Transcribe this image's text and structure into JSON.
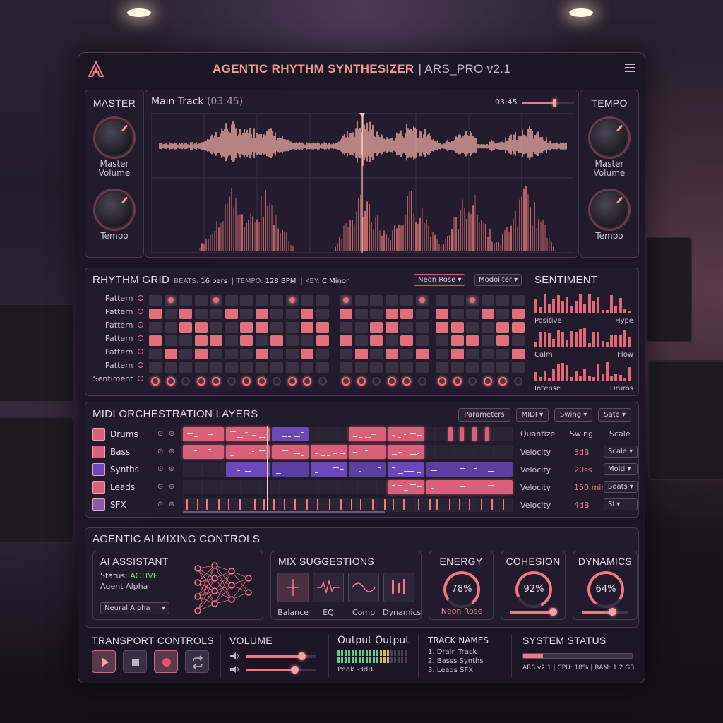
{
  "app": {
    "title": "AGENTIC RHYTHM SYNTHESIZER",
    "version": "| ARS_PRO v2.1",
    "accent": "#f07888"
  },
  "master": {
    "title": "MASTER",
    "knob1": "Master Volume",
    "knob2": "Tempo"
  },
  "tempo": {
    "title": "TEMPO",
    "knob1": "Master Volume",
    "knob2": "Tempo"
  },
  "track": {
    "name": "Main Track",
    "duration": "(03:45)",
    "time": "03:45"
  },
  "rhythm": {
    "title": "RHYTHM GRID",
    "beats_label": "BEATS:",
    "beats": "16 bars",
    "tempo_label": "| TEMPO:",
    "tempo": "128 BPM",
    "key_label": "| KEY:",
    "key": "C Minor",
    "preset": "Neon Rose",
    "mod": "Modoiiter",
    "rows": [
      "Pattern",
      "Pattern",
      "Pattern",
      "Pattern",
      "Pattern",
      "Pattern",
      "Sentiment"
    ]
  },
  "sentiment": {
    "title": "SENTIMENT",
    "groups": [
      {
        "left": "Positive",
        "right": "Hype"
      },
      {
        "left": "Calm",
        "right": "Flow"
      },
      {
        "left": "Intense",
        "right": "Drums"
      }
    ]
  },
  "midi": {
    "title": "MIDI ORCHESTRATION LAYERS",
    "buttons": [
      "Parameters",
      "MIDI",
      "Swing",
      "Sate"
    ],
    "tracks": [
      {
        "name": "Drums",
        "color": "#d8607a"
      },
      {
        "name": "Bass",
        "color": "#d8607a"
      },
      {
        "name": "Synths",
        "color": "#6a48b8"
      },
      {
        "name": "Leads",
        "color": "#d8607a"
      },
      {
        "name": "SFX",
        "color": "#8a5aa8"
      }
    ],
    "headers": [
      "Quantize",
      "Swing",
      "Scale"
    ],
    "params": [
      {
        "label": "Velocity",
        "value": "3dB",
        "option": "Scale"
      },
      {
        "label": "Velocity",
        "value": "20ss",
        "option": "Moiti"
      },
      {
        "label": "Velocity",
        "value": "150 min",
        "option": "Soats"
      },
      {
        "label": "Velocity",
        "value": "4dB",
        "option": "Sl"
      }
    ]
  },
  "mixing": {
    "title": "AGENTIC AI MIXING CONTROLS",
    "assistant": {
      "title": "AI ASSISTANT",
      "status_label": "Status:",
      "status": "ACTIVE",
      "agent": "Agent Alpha",
      "select": "Neural Alpha"
    },
    "suggestions": {
      "title": "MIX SUGGESTIONS",
      "items": [
        "Balance",
        "EQ",
        "Comp",
        "Dynamics"
      ]
    },
    "energy": {
      "title": "ENERGY",
      "value": "78%",
      "sub": "Neon Rose",
      "slider": 0.78
    },
    "cohesion": {
      "title": "COHESION",
      "value": "92%",
      "slider": 0.92
    },
    "dynamics": {
      "title": "DYNAMICS",
      "value": "64%",
      "slider": 0.64
    }
  },
  "transport": {
    "title": "TRANSPORT CONTROLS"
  },
  "volume": {
    "title": "VOLUME",
    "levels": [
      0.78,
      0.68
    ]
  },
  "output": {
    "title": "Output Output",
    "peak": "Peak -3dB"
  },
  "tracknames": {
    "title": "TRACK NAMES",
    "items": [
      "1. Drain Track",
      "2. Basss Synths",
      "3. Leads SFX"
    ]
  },
  "system": {
    "title": "SYSTEM STATUS",
    "info": "ARS v2.1 | CPU: 18% | RAM: 1.2 GB",
    "load": 0.18
  }
}
